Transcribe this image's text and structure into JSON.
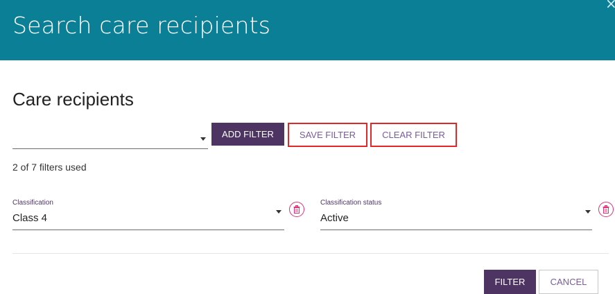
{
  "dialog": {
    "title": "Search care recipients",
    "close_icon": "close-icon",
    "close_glyph": "×"
  },
  "section": {
    "title": "Care recipients"
  },
  "filter_select": {
    "value": ""
  },
  "toolbar": {
    "add_filter_label": "ADD FILTER",
    "save_filter_label": "SAVE FILTER",
    "clear_filter_label": "CLEAR FILTER"
  },
  "filters_used_text": "2 of 7 filters used",
  "filters": [
    {
      "label": "Classification",
      "value": "Class 4"
    },
    {
      "label": "Classification status",
      "value": "Active"
    }
  ],
  "footer": {
    "filter_label": "FILTER",
    "cancel_label": "CANCEL"
  },
  "colors": {
    "header_bg": "#0b7f96",
    "primary_button": "#4e3463",
    "highlight_border": "#e02828",
    "trash_icon": "#e0307a"
  }
}
